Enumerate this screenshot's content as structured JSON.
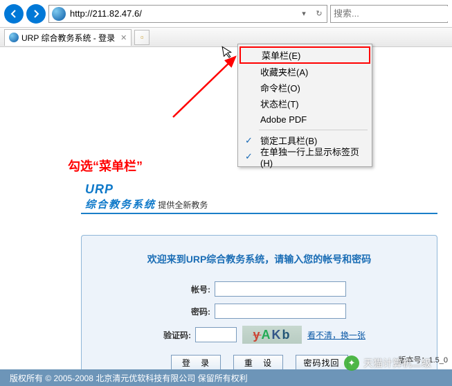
{
  "toolbar": {
    "url": "http://211.82.47.6/",
    "search_placeholder": "搜索..."
  },
  "tab": {
    "title": "URP 综合教务系统 - 登录"
  },
  "annotation": {
    "text": "勾选“菜单栏”"
  },
  "ctx": {
    "items": [
      "菜单栏(E)",
      "收藏夹栏(A)",
      "命令栏(O)",
      "状态栏(T)",
      "Adobe PDF"
    ],
    "items2": [
      "锁定工具栏(B)",
      "在单独一行上显示标签页(H)"
    ]
  },
  "urp": {
    "title": "URP",
    "subtitle": "综合教务系统",
    "tagline": "提供全新教务"
  },
  "login": {
    "welcome": "欢迎来到URP综合教务系统，请输入您的帐号和密码",
    "labels": {
      "user": "帐号:",
      "pass": "密码:",
      "captcha": "验证码:"
    },
    "captcha_text": "yAKb",
    "captcha_link": "看不清，换一张",
    "buttons": {
      "login": "登 录",
      "reset": "重 设",
      "pwd": "密码找回"
    }
  },
  "version": "版本号：1.5_0",
  "footer": "版权所有 © 2005-2008 北京清元优软科技有限公司 保留所有权利",
  "watermark": "天猫计算机二级"
}
